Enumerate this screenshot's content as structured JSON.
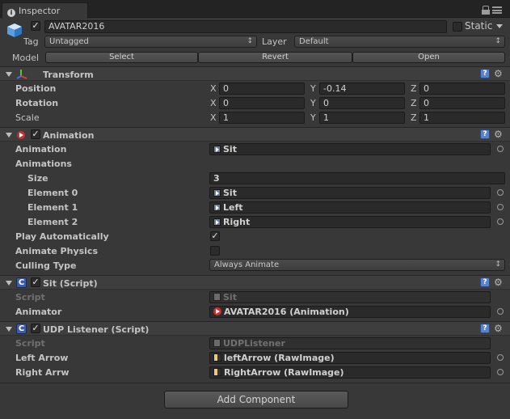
{
  "window": {
    "tab_label": "Inspector",
    "info_glyph": "i"
  },
  "object": {
    "name": "AVATAR2016",
    "active": true,
    "static_label": "Static",
    "static_checked": false,
    "tag_label": "Tag",
    "tag_value": "Untagged",
    "layer_label": "Layer",
    "layer_value": "Default",
    "model_label": "Model",
    "model_buttons": [
      "Select",
      "Revert",
      "Open"
    ]
  },
  "transform": {
    "title": "Transform",
    "rows": [
      {
        "label": "Position",
        "x": "0",
        "y": "-0.14",
        "z": "0"
      },
      {
        "label": "Rotation",
        "x": "0",
        "y": "0",
        "z": "0"
      },
      {
        "label": "Scale",
        "x": "1",
        "y": "1",
        "z": "1"
      }
    ],
    "axis_labels": [
      "X",
      "Y",
      "Z"
    ]
  },
  "animation": {
    "title": "Animation",
    "enabled": true,
    "animation_label": "Animation",
    "animation_value": "Sit",
    "animations_label": "Animations",
    "size_label": "Size",
    "size_value": "3",
    "elements": [
      {
        "label": "Element 0",
        "value": "Sit"
      },
      {
        "label": "Element 1",
        "value": "Left"
      },
      {
        "label": "Element 2",
        "value": "Right"
      }
    ],
    "play_auto_label": "Play Automatically",
    "play_auto_checked": true,
    "animate_physics_label": "Animate Physics",
    "animate_physics_checked": false,
    "culling_label": "Culling Type",
    "culling_value": "Always Animate"
  },
  "sit_script": {
    "title": "Sit (Script)",
    "enabled": true,
    "script_label": "Script",
    "script_value": "Sit",
    "animator_label": "Animator",
    "animator_value": "AVATAR2016 (Animation)"
  },
  "udp_script": {
    "title": "UDP Listener (Script)",
    "enabled": true,
    "script_label": "Script",
    "script_value": "UDPListener",
    "left_label": "Left Arrow",
    "left_value": "leftArrow (RawImage)",
    "right_label": "Right Arrw",
    "right_value": "RightArrow (RawImage)"
  },
  "add_component_label": "Add Component",
  "icons": {
    "help": "?",
    "gear": "⚙",
    "check": "✓",
    "cs": "C"
  }
}
